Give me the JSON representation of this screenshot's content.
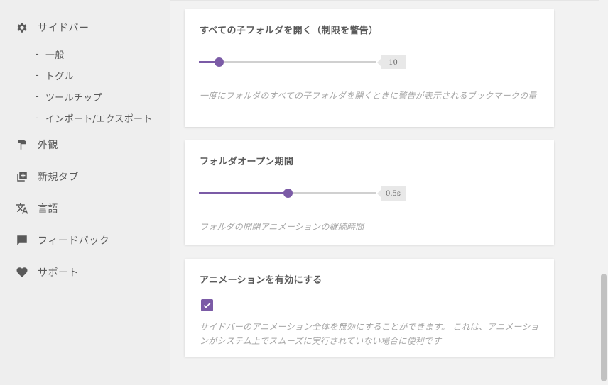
{
  "sidebar": {
    "items": [
      {
        "label": "サイドバー",
        "icon": "gear-icon"
      },
      {
        "label": "外観",
        "icon": "paint-roller-icon"
      },
      {
        "label": "新規タブ",
        "icon": "new-tab-icon"
      },
      {
        "label": "言語",
        "icon": "translate-icon"
      },
      {
        "label": "フィードバック",
        "icon": "comment-icon"
      },
      {
        "label": "サポート",
        "icon": "heart-icon"
      }
    ],
    "sub_items": [
      {
        "label": "一般"
      },
      {
        "label": "トグル"
      },
      {
        "label": "ツールチップ"
      },
      {
        "label": "インポート/エクスポート"
      }
    ],
    "sub_dash": "-"
  },
  "settings": {
    "open_all_children": {
      "title": "すべての子フォルダを開く（制限を警告）",
      "value": "10",
      "slider_fraction": 0.11,
      "description": "一度にフォルダのすべての子フォルダを開くときに警告が表示されるブックマークの量"
    },
    "folder_open_duration": {
      "title": "フォルダオープン期間",
      "value": "0.5s",
      "slider_fraction": 0.5,
      "description": "フォルダの開閉アニメーションの継続時間"
    },
    "enable_animations": {
      "title": "アニメーションを有効にする",
      "checked": true,
      "description": "サイドバーのアニメーション全体を無効にすることができます。 これは、アニメーションがシステム上でスムーズに実行されていない場合に便利です"
    }
  },
  "colors": {
    "accent": "#7b5ba6",
    "sidebar_bg": "#eeeeee",
    "card_bg": "#ffffff",
    "text": "#5a5a5a",
    "muted_text": "#a6a6a6"
  }
}
